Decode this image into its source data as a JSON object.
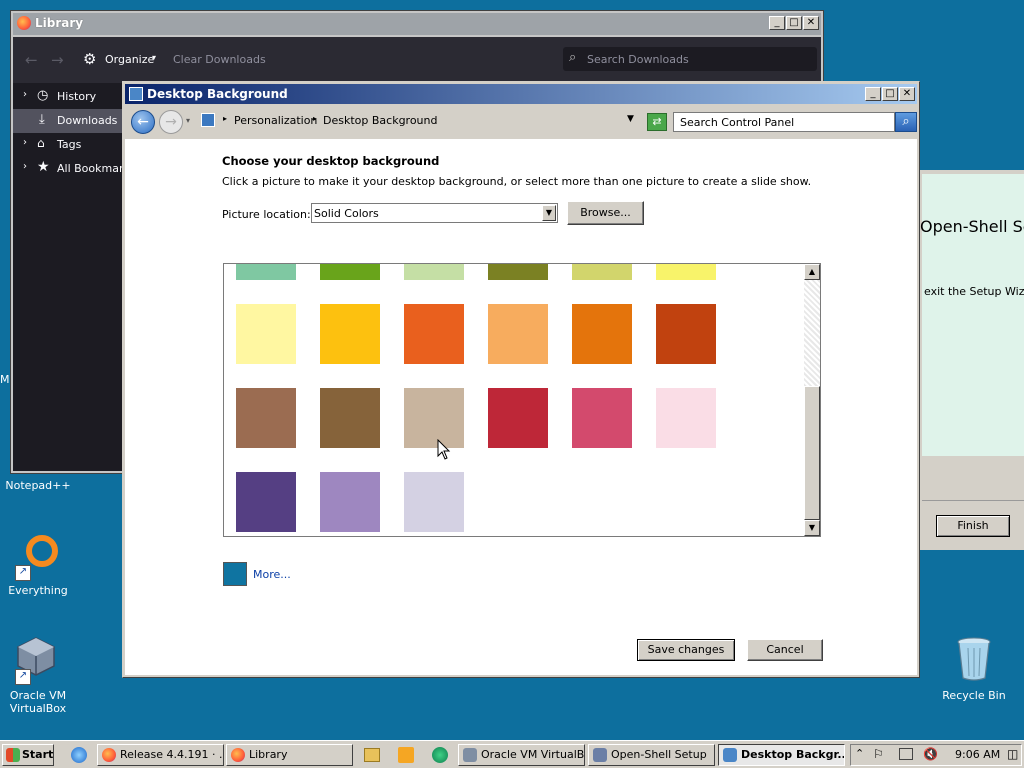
{
  "desktop": {
    "icons": [
      {
        "label": "Notepad++"
      },
      {
        "label": "Everything"
      },
      {
        "label": "Oracle VM VirtualBox"
      },
      {
        "label": "Recycle Bin"
      }
    ]
  },
  "library": {
    "title": "Library",
    "toolbar": {
      "organize": "Organize",
      "clear": "Clear Downloads",
      "search_placeholder": "Search Downloads"
    },
    "sidebar": [
      {
        "label": "History"
      },
      {
        "label": "Downloads"
      },
      {
        "label": "Tags"
      },
      {
        "label": "All Bookmarks"
      }
    ]
  },
  "openshell": {
    "title": "Open-Shell Setup",
    "text": "exit the Setup Wizard",
    "finish": "Finish"
  },
  "dialog": {
    "title": "Desktop Background",
    "breadcrumb": [
      "Personalization",
      "Desktop Background"
    ],
    "search_placeholder": "Search Control Panel",
    "heading": "Choose your desktop background",
    "description": "Click a picture to make it your desktop background, or select more than one picture to create a slide show.",
    "location_label": "Picture location:",
    "location_value": "Solid Colors",
    "browse": "Browse...",
    "more": "More...",
    "more_color": "#0f74a1",
    "save": "Save changes",
    "cancel": "Cancel",
    "swatches_top": [
      "#7fc8a2",
      "#69a41b",
      "#c5dfa5",
      "#7b8123",
      "#d2d56c",
      "#f8f36a"
    ],
    "swatches": [
      [
        "#fff7a1",
        "#fdc10f",
        "#e9601e",
        "#f7ac5e",
        "#e4740c",
        "#c1420f"
      ],
      [
        "#9b6c51",
        "#86633a",
        "#c8b49e",
        "#be2738",
        "#d34a6d",
        "#fadde6"
      ],
      [
        "#553f83",
        "#9e87c0",
        "#d4d1e3"
      ]
    ]
  },
  "taskbar": {
    "start": "Start",
    "tasks": [
      {
        "label": "Release 4.4.191 · ..."
      },
      {
        "label": "Library"
      },
      {
        "label": "Oracle VM VirtualB..."
      },
      {
        "label": "Open-Shell Setup"
      },
      {
        "label": "Desktop Backgr..."
      }
    ],
    "clock": "9:06 AM"
  }
}
